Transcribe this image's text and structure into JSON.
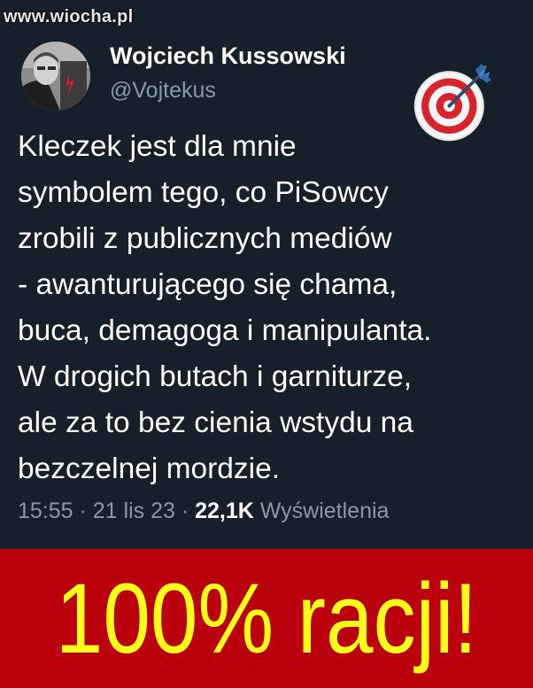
{
  "watermark": "www.wiocha.pl",
  "author": {
    "display_name": "Wojciech Kussowski",
    "handle": "@Vojtekus"
  },
  "tweet": {
    "lines": [
      "Kleczek jest dla mnie",
      "symbolem tego, co PiSowcy",
      "zrobili z publicznych mediów",
      "- awanturującego się chama,",
      "buca, demagoga i manipulanta.",
      "W drogich butach i garniturze,",
      "ale za to bez cienia wstydu na",
      "bezczelnej mordzie."
    ],
    "time": "15:55",
    "separator1": " · ",
    "date": "21 lis 23",
    "separator2": " · ",
    "views_count": "22,1K",
    "views_label": " Wyświetlenia"
  },
  "banner": {
    "text": "100% racji!"
  },
  "icons": {
    "emoji": "direct-hit-target-icon",
    "avatar": "profile-photo"
  },
  "colors": {
    "tweet_background": "#15202b",
    "text_primary": "#ffffff",
    "text_secondary": "#8b98a5",
    "banner_background": "#b9000c",
    "banner_text": "#ffff1a"
  }
}
